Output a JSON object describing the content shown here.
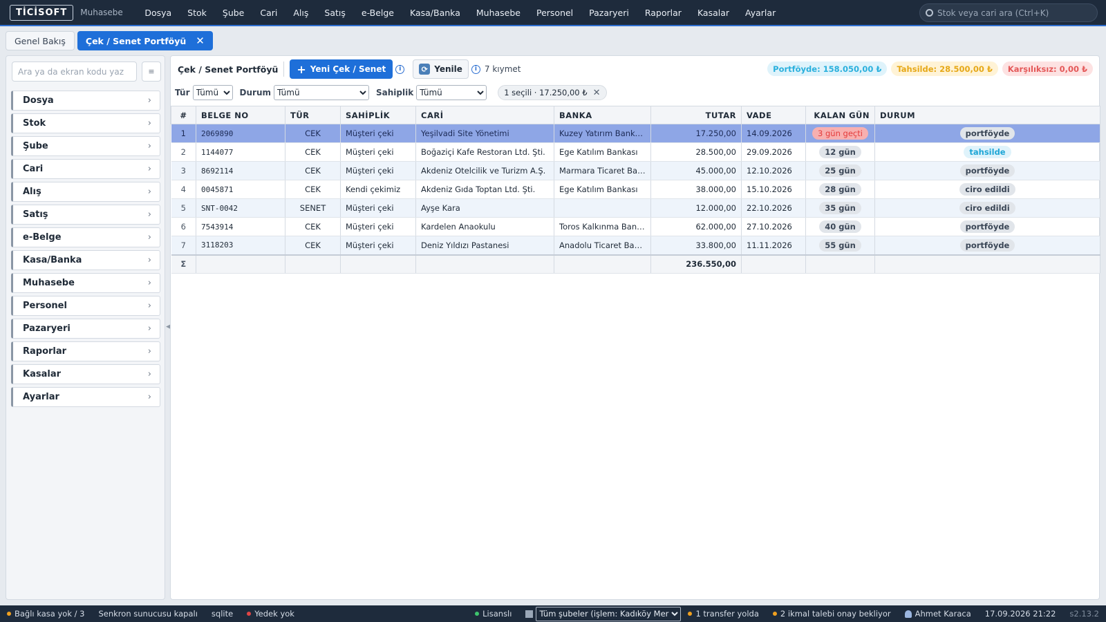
{
  "app": {
    "logo": "TİCİSOFT",
    "module": "Muhasebe"
  },
  "menu": [
    "Dosya",
    "Stok",
    "Şube",
    "Cari",
    "Alış",
    "Satış",
    "e-Belge",
    "Kasa/Banka",
    "Muhasebe",
    "Personel",
    "Pazaryeri",
    "Raporlar",
    "Kasalar",
    "Ayarlar"
  ],
  "search": {
    "placeholder": "Stok veya cari ara (Ctrl+K)"
  },
  "tabs": [
    {
      "label": "Genel Bakış",
      "active": false
    },
    {
      "label": "Çek / Senet Portföyü",
      "active": true
    }
  ],
  "sidebar": {
    "search_placeholder": "Ara ya da ekran kodu yaz",
    "items": [
      "Dosya",
      "Stok",
      "Şube",
      "Cari",
      "Alış",
      "Satış",
      "e-Belge",
      "Kasa/Banka",
      "Muhasebe",
      "Personel",
      "Pazaryeri",
      "Raporlar",
      "Kasalar",
      "Ayarlar"
    ]
  },
  "toolbar": {
    "title": "Çek / Senet Portföyü",
    "new_label": "Yeni Çek / Senet",
    "refresh_label": "Yenile",
    "count": "7 kıymet",
    "badges": {
      "portfoyde": "Portföyde: 158.050,00 ₺",
      "tahsilde": "Tahsilde: 28.500,00 ₺",
      "karsiliksiz": "Karşılıksız: 0,00 ₺"
    }
  },
  "filters": {
    "tur_label": "Tür",
    "tur_value": "Tümü",
    "durum_label": "Durum",
    "durum_value": "Tümü",
    "sahiplik_label": "Sahiplik",
    "sahiplik_value": "Tümü",
    "selection_chip": "1 seçili · 17.250,00 ₺"
  },
  "grid": {
    "headers": [
      "#",
      "BELGE NO",
      "TÜR",
      "SAHİPLİK",
      "CARİ",
      "BANKA",
      "TUTAR",
      "VADE",
      "KALAN GÜN",
      "DURUM"
    ],
    "rows": [
      {
        "idx": "1",
        "belge": "2069890",
        "tur": "CEK",
        "sahiplik": "Müşteri çeki",
        "cari": "Yeşilvadi Site Yönetimi",
        "banka": "Kuzey Yatırım Bankası",
        "tutar": "17.250,00",
        "vade": "14.09.2026",
        "kalan": "3 gün geçti",
        "durum": "portföyde"
      },
      {
        "idx": "2",
        "belge": "1144077",
        "tur": "CEK",
        "sahiplik": "Müşteri çeki",
        "cari": "Boğaziçi Kafe Restoran Ltd. Şti.",
        "banka": "Ege Katılım Bankası",
        "tutar": "28.500,00",
        "vade": "29.09.2026",
        "kalan": "12 gün",
        "durum": "tahsilde"
      },
      {
        "idx": "3",
        "belge": "8692114",
        "tur": "CEK",
        "sahiplik": "Müşteri çeki",
        "cari": "Akdeniz Otelcilik ve Turizm A.Ş.",
        "banka": "Marmara Ticaret Bank...",
        "tutar": "45.000,00",
        "vade": "12.10.2026",
        "kalan": "25 gün",
        "durum": "portföyde"
      },
      {
        "idx": "4",
        "belge": "0045871",
        "tur": "CEK",
        "sahiplik": "Kendi çekimiz",
        "cari": "Akdeniz Gıda Toptan Ltd. Şti.",
        "banka": "Ege Katılım Bankası",
        "tutar": "38.000,00",
        "vade": "15.10.2026",
        "kalan": "28 gün",
        "durum": "ciro edildi"
      },
      {
        "idx": "5",
        "belge": "SNT-0042",
        "tur": "SENET",
        "sahiplik": "Müşteri çeki",
        "cari": "Ayşe Kara",
        "banka": "",
        "tutar": "12.000,00",
        "vade": "22.10.2026",
        "kalan": "35 gün",
        "durum": "ciro edildi"
      },
      {
        "idx": "6",
        "belge": "7543914",
        "tur": "CEK",
        "sahiplik": "Müşteri çeki",
        "cari": "Kardelen Anaokulu",
        "banka": "Toros Kalkınma Bankası",
        "tutar": "62.000,00",
        "vade": "27.10.2026",
        "kalan": "40 gün",
        "durum": "portföyde"
      },
      {
        "idx": "7",
        "belge": "3118203",
        "tur": "CEK",
        "sahiplik": "Müşteri çeki",
        "cari": "Deniz Yıldızı Pastanesi",
        "banka": "Anadolu Ticaret Bankası",
        "tutar": "33.800,00",
        "vade": "11.11.2026",
        "kalan": "55 gün",
        "durum": "portföyde"
      }
    ],
    "sum_symbol": "Σ",
    "sum_total": "236.550,00"
  },
  "statusbar": {
    "kasa": "Bağlı kasa yok / 3",
    "senkron": "Senkron sunucusu kapalı",
    "db": "sqlite",
    "yedek": "Yedek yok",
    "lisans": "Lisanslı",
    "sube_select": "Tüm şubeler (işlem: Kadıköy Merkez)",
    "transfer": "1 transfer yolda",
    "ikmal": "2 ikmal talebi onay bekliyor",
    "user": "Ahmet Karaca",
    "datetime": "17.09.2026 21:22",
    "version": "s2.13.2"
  },
  "colors": {
    "topbar": "#1e2b3c",
    "accent": "#1e6fd9",
    "selected_row": "#8ea6e6"
  }
}
